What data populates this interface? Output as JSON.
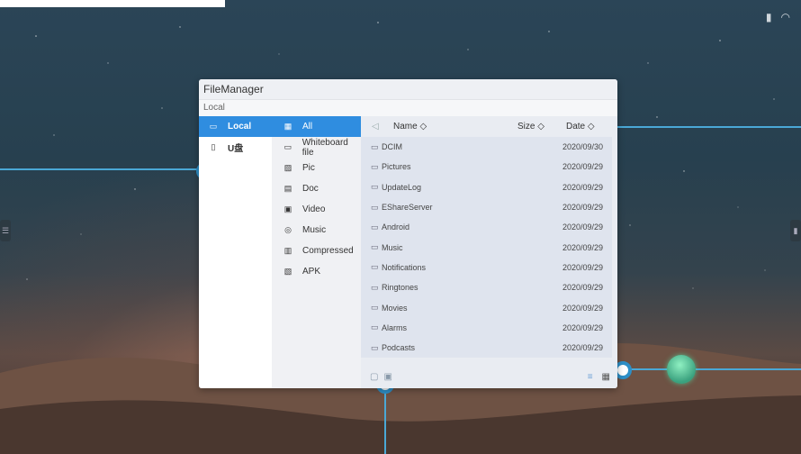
{
  "window": {
    "title": "FileManager",
    "path": "Local"
  },
  "devices": [
    {
      "label": "Local",
      "icon": "monitor-icon",
      "active": true
    },
    {
      "label": "U盘",
      "icon": "usb-icon",
      "active": false
    }
  ],
  "categories": [
    {
      "label": "All",
      "icon": "grid-icon",
      "active": true
    },
    {
      "label": "Whiteboard file",
      "icon": "whiteboard-icon"
    },
    {
      "label": "Pic",
      "icon": "image-icon"
    },
    {
      "label": "Doc",
      "icon": "document-icon"
    },
    {
      "label": "Video",
      "icon": "video-icon"
    },
    {
      "label": "Music",
      "icon": "music-icon"
    },
    {
      "label": "Compressed",
      "icon": "archive-icon"
    },
    {
      "label": "APK",
      "icon": "apk-icon"
    }
  ],
  "list_header": {
    "name": "Name ◇",
    "size": "Size ◇",
    "date": "Date ◇"
  },
  "files": [
    {
      "name": "DCIM",
      "date": "2020/09/30"
    },
    {
      "name": "Pictures",
      "date": "2020/09/29"
    },
    {
      "name": "UpdateLog",
      "date": "2020/09/29"
    },
    {
      "name": "EShareServer",
      "date": "2020/09/29"
    },
    {
      "name": "Android",
      "date": "2020/09/29"
    },
    {
      "name": "Music",
      "date": "2020/09/29"
    },
    {
      "name": "Notifications",
      "date": "2020/09/29"
    },
    {
      "name": "Ringtones",
      "date": "2020/09/29"
    },
    {
      "name": "Movies",
      "date": "2020/09/29"
    },
    {
      "name": "Alarms",
      "date": "2020/09/29"
    },
    {
      "name": "Podcasts",
      "date": "2020/09/29"
    }
  ],
  "colors": {
    "accent": "#2f8de0",
    "callout": "#2d8fc7"
  }
}
